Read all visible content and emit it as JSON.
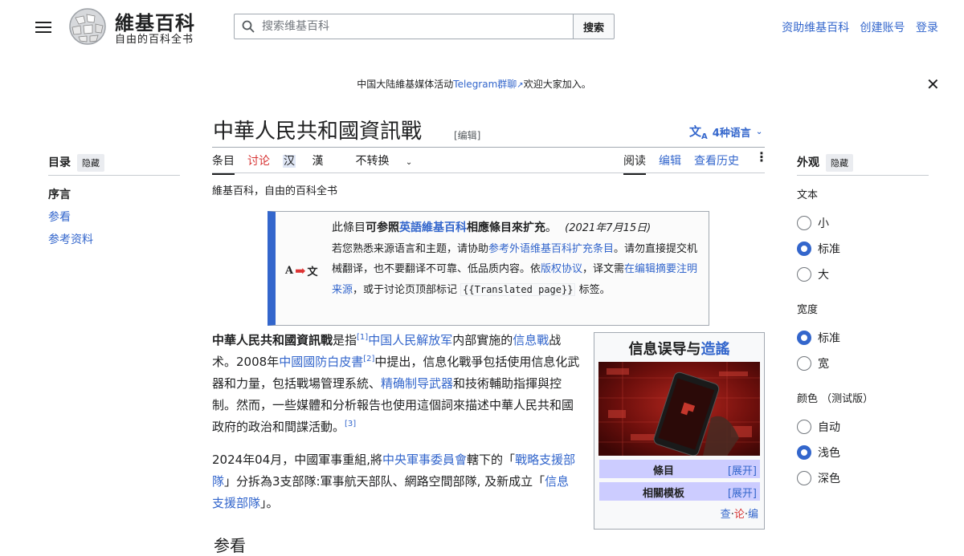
{
  "header": {
    "site_title": "維基百科",
    "site_tagline": "自由的百科全书",
    "search_placeholder": "搜索维基百科",
    "search_button": "搜索",
    "user_links": [
      "资助维基百科",
      "创建账号",
      "登录"
    ]
  },
  "banner": {
    "prefix": "中国大陆維基媒体活动",
    "link": "Telegram群聊",
    "suffix": "欢迎大家加入。"
  },
  "article": {
    "title": "中華人民共和國資訊戰",
    "edit": "[编辑]",
    "languages": "4种语言",
    "tagline": "維基百科，自由的百科全书"
  },
  "tabs_left": [
    "条目",
    "讨论",
    "汉",
    "漢",
    "不转换"
  ],
  "tabs_right": [
    "阅读",
    "编辑",
    "查看历史"
  ],
  "toc": {
    "title": "目录",
    "hide": "隐藏",
    "items": [
      "序言",
      "参看",
      "参考资料"
    ]
  },
  "ambox": {
    "line1_a": "此條目",
    "line1_b": "可参照",
    "line1_link": "英語維基百科",
    "line1_c": "相應條目來扩充",
    "line1_d": "。",
    "date": "(2021年7月15日)",
    "t1": "若您熟悉来源语言和主题，请协助",
    "l1": "参考外语维基百科扩充条目",
    "t2": "。请勿直接提交机械翻译，也不要翻译不可靠、低品质内容。依",
    "l2": "版权协议",
    "t3": "，译文需",
    "l3": "在编辑摘要注明来源",
    "t4": "，或于讨论页顶部标记",
    "code": "{{Translated page}}",
    "t5": "标签。"
  },
  "para1": {
    "bold": "中華人民共和國資訊戰",
    "t1": "是指",
    "ref1": "[1]",
    "l1": "中国人民解放军",
    "t2": "内部實施的",
    "l2": "信息戰",
    "t3": "战术。2008年",
    "l3": "中國國防白皮書",
    "ref2": "[2]",
    "t4": "中提出，信息化戰爭包括使用信息化武器和力量，包括戰場管理系統、",
    "l4": "精确制导武器",
    "t5": "和技術輔助指揮與控制。然而，一些媒體和分析報告也使用這個詞來描述中華人民共和國政府的政治和間諜活動。",
    "ref3": "[3]"
  },
  "para2": {
    "t1": "2024年04月，中國軍事重組,將",
    "l1": "中央軍事委員會",
    "t2": "轄下的「",
    "l2": "戰略支援部隊",
    "t3": "」分拆為3支部隊:軍事航天部队、網路空間部隊, 及新成立「",
    "l3": "信息支援部隊",
    "t4": "」。"
  },
  "infobox": {
    "title_a": "信息误导与",
    "title_link": "造謠",
    "rows": [
      {
        "label": "條目",
        "action": "[展开]"
      },
      {
        "label": "相關模板",
        "action": "[展开]"
      }
    ],
    "nav": [
      "查",
      "论",
      "编"
    ]
  },
  "next_heading": "参看",
  "appearance": {
    "title": "外观",
    "hide": "隐藏",
    "text_label": "文本",
    "text_options": [
      "小",
      "标准",
      "大"
    ],
    "text_selected": "标准",
    "width_label": "宽度",
    "width_options": [
      "标准",
      "宽"
    ],
    "width_selected": "标准",
    "color_label": "颜色 （测试版）",
    "color_options": [
      "自动",
      "浅色",
      "深色"
    ],
    "color_selected": "浅色"
  }
}
